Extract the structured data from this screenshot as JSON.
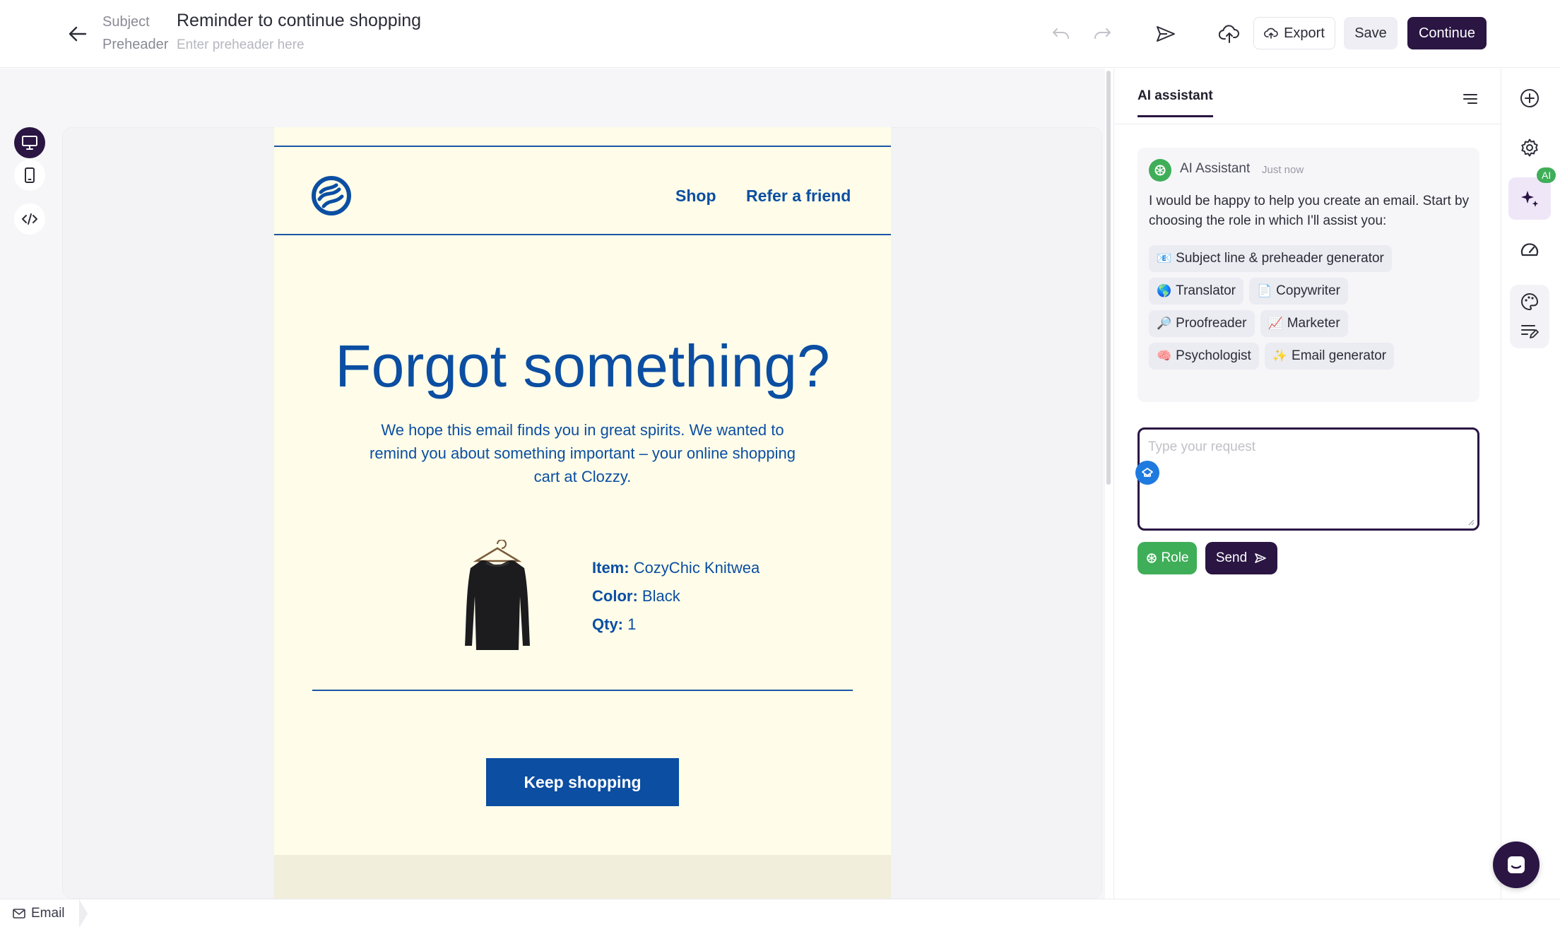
{
  "header": {
    "subject_label": "Subject",
    "subject_value": "Reminder to continue shopping",
    "preheader_label": "Preheader",
    "preheader_placeholder": "Enter preheader here",
    "export_label": "Export",
    "save_label": "Save",
    "continue_label": "Continue"
  },
  "email": {
    "nav": [
      "Shop",
      "Refer a friend"
    ],
    "title": "Forgot something?",
    "body": "We hope this email finds you in great spirits. We wanted to remind you about something important – your online shopping cart at Clozzy.",
    "item_label": "Item:",
    "item_value": "CozyChic Knitwea",
    "color_label": "Color:",
    "color_value": "Black",
    "qty_label": "Qty:",
    "qty_value": "1",
    "cta": "Keep shopping",
    "brand_color": "#0b4ea2",
    "background_color": "#fffde9"
  },
  "assistant": {
    "tab_label": "AI assistant",
    "sender": "AI Assistant",
    "timestamp": "Just now",
    "message": "I would be happy to help you create an email. Start by choosing the role in which I'll assist you:",
    "roles": [
      {
        "icon": "📧",
        "label": "Subject line & preheader generator"
      },
      {
        "icon": "🌎",
        "label": "Translator"
      },
      {
        "icon": "📄",
        "label": "Copywriter"
      },
      {
        "icon": "🔎",
        "label": "Proofreader"
      },
      {
        "icon": "📈",
        "label": "Marketer"
      },
      {
        "icon": "🧠",
        "label": "Psychologist"
      },
      {
        "icon": "✨",
        "label": "Email generator"
      }
    ],
    "input_placeholder": "Type your request",
    "role_button": "Role",
    "send_button": "Send"
  },
  "rail": {
    "ai_badge": "AI"
  },
  "bottom": {
    "tab_label": "Email"
  },
  "colors": {
    "primary": "#2a1543",
    "accent_green": "#3fae58",
    "accent_blue": "#1f7ae0"
  }
}
